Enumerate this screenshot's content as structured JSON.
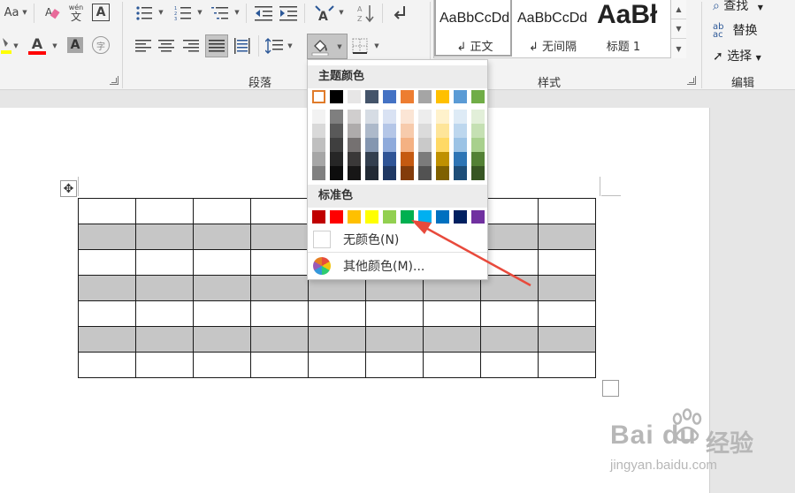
{
  "ribbon": {
    "font_group": {
      "font_size_label": "Aa",
      "phonetic_label": "wén",
      "phonetic_char": "文",
      "char_border_label": "A",
      "font_color_label": "A",
      "char_shading_label": "A",
      "enclose_char_label": "字",
      "highlight_color": "#ffff00",
      "font_color": "#ff0000"
    },
    "paragraph_group": {
      "label": "段落"
    },
    "styles_group": {
      "label": "样式",
      "items": [
        {
          "sample": "AaBbCcDd",
          "name": "正文",
          "mark": "↲"
        },
        {
          "sample": "AaBbCcDd",
          "name": "无间隔",
          "mark": "↲"
        },
        {
          "sample": "AaBł",
          "name": "标题 1",
          "mark": ""
        }
      ]
    },
    "editing_group": {
      "label": "编辑",
      "find": "查找",
      "replace": "替换",
      "select": "选择"
    }
  },
  "color_dropdown": {
    "theme_header": "主题颜色",
    "standard_header": "标准色",
    "no_color": "无颜色(N)",
    "more_colors": "其他颜色(M)...",
    "theme_colors": [
      "#ffffff",
      "#000000",
      "#e7e6e6",
      "#44546a",
      "#4472c4",
      "#ed7d31",
      "#a5a5a5",
      "#ffc000",
      "#5b9bd5",
      "#70ad47"
    ],
    "theme_tints": [
      [
        "#f2f2f2",
        "#d9d9d9",
        "#bfbfbf",
        "#a6a6a6",
        "#808080"
      ],
      [
        "#7f7f7f",
        "#595959",
        "#3f3f3f",
        "#262626",
        "#0d0d0d"
      ],
      [
        "#d0cece",
        "#aeabab",
        "#757171",
        "#3a3838",
        "#171616"
      ],
      [
        "#d6dce4",
        "#adb9ca",
        "#8496b0",
        "#333f4f",
        "#222a35"
      ],
      [
        "#d9e2f3",
        "#b4c6e7",
        "#8eaadb",
        "#2f5496",
        "#1f3864"
      ],
      [
        "#fbe5d5",
        "#f7cbac",
        "#f4b183",
        "#c55a11",
        "#833c0b"
      ],
      [
        "#ededed",
        "#dbdbdb",
        "#c9c9c9",
        "#7b7b7b",
        "#525252"
      ],
      [
        "#fff2cc",
        "#fee599",
        "#ffd965",
        "#bf9000",
        "#7f6000"
      ],
      [
        "#deebf6",
        "#bdd7ee",
        "#9cc3e5",
        "#2e75b5",
        "#1e4e79"
      ],
      [
        "#e2efd9",
        "#c5e0b3",
        "#a8d08d",
        "#538135",
        "#375623"
      ]
    ],
    "standard_colors": [
      "#c00000",
      "#ff0000",
      "#ffc000",
      "#ffff00",
      "#92d050",
      "#00b050",
      "#00b0f0",
      "#0070c0",
      "#002060",
      "#7030a0"
    ]
  },
  "table": {
    "rows": 7,
    "cols": 9,
    "shaded_rows": [
      1,
      3,
      5
    ],
    "shade_color": "#c6c6c6"
  },
  "watermark": {
    "logo": "Bai du",
    "brand_cn": "经验",
    "url": "jingyan.baidu.com"
  }
}
